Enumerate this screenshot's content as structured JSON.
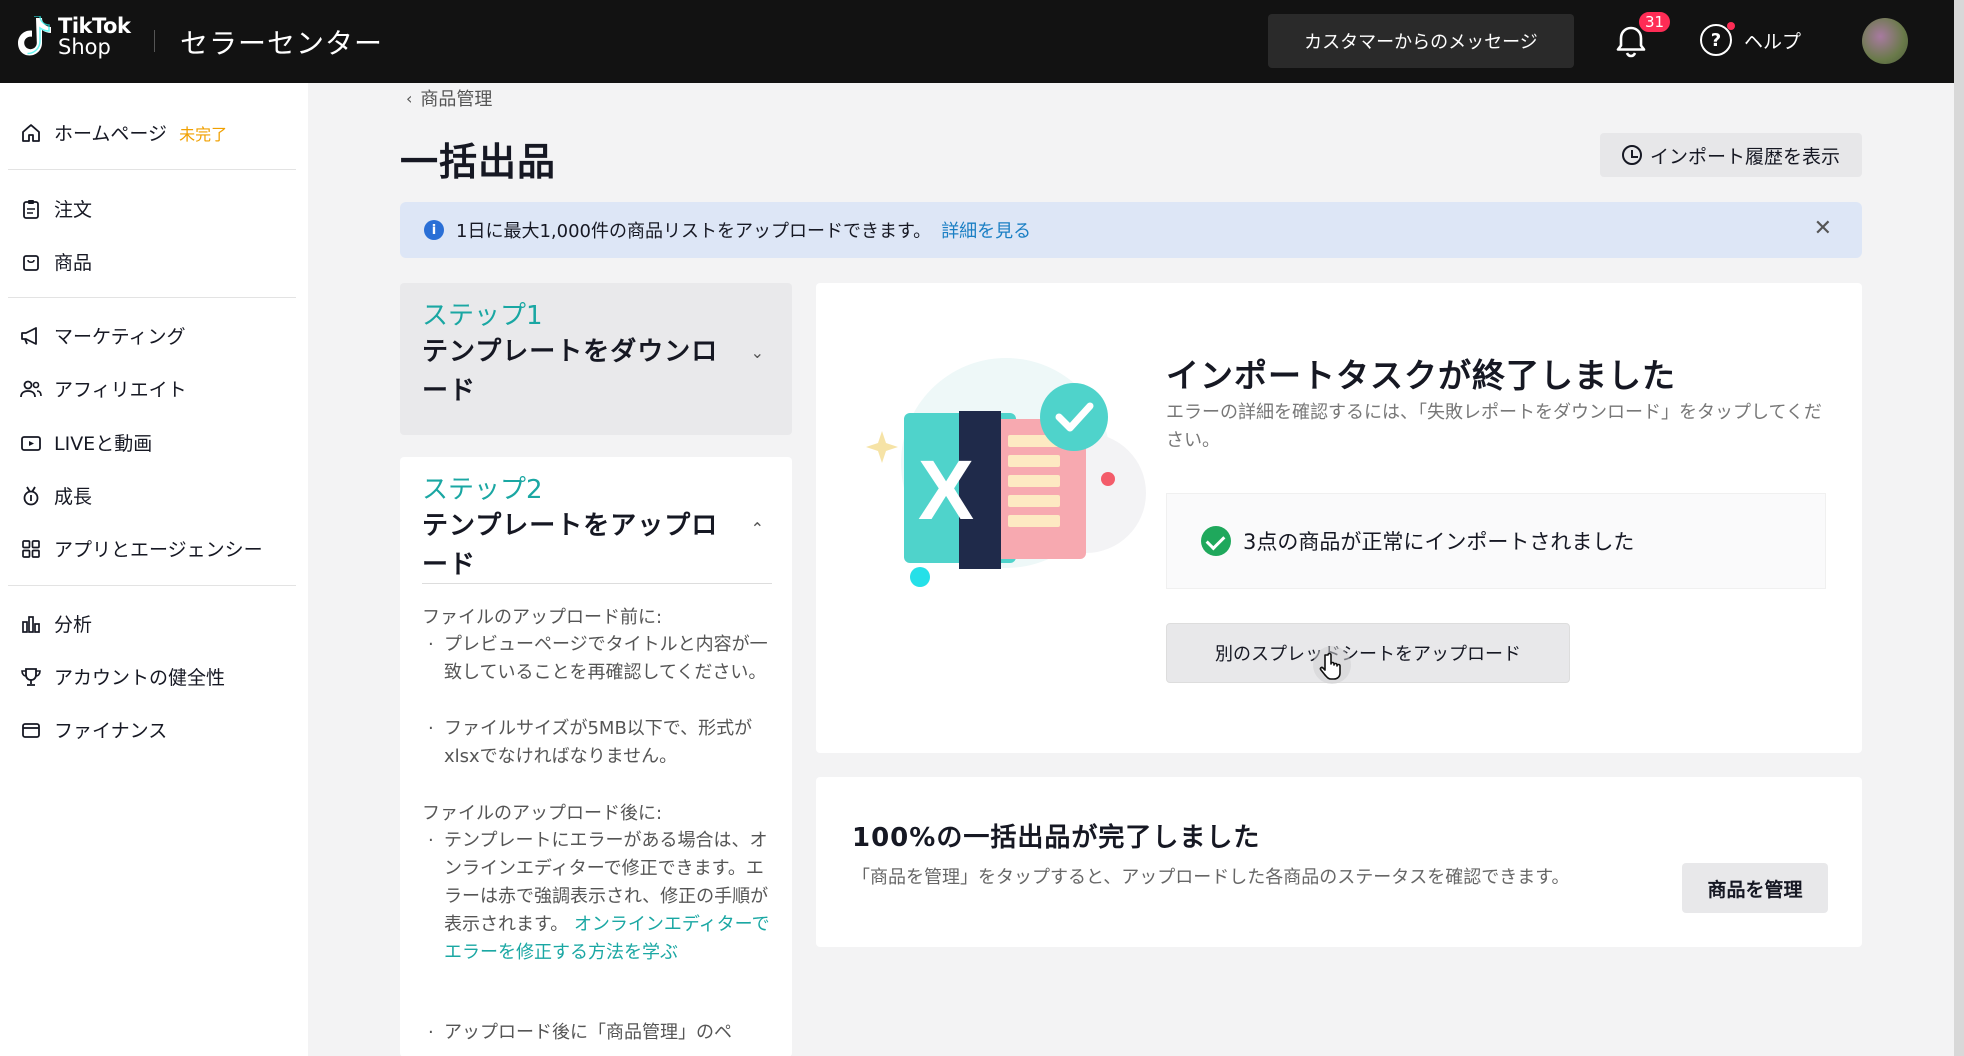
{
  "header": {
    "logo_line1": "TikTok",
    "logo_line2": "Shop",
    "app_title": "セラーセンター",
    "messages_button": "カスタマーからのメッセージ",
    "notifications_count": "31",
    "help_label": "ヘルプ"
  },
  "sidebar": {
    "items": [
      {
        "label": "ホームページ",
        "tag": "未完了",
        "icon": "home-icon"
      },
      {
        "label": "注文",
        "icon": "clipboard-icon"
      },
      {
        "label": "商品",
        "icon": "bag-icon"
      },
      {
        "label": "マーケティング",
        "icon": "megaphone-icon"
      },
      {
        "label": "アフィリエイト",
        "icon": "people-icon"
      },
      {
        "label": "LIVEと動画",
        "icon": "video-icon"
      },
      {
        "label": "成長",
        "icon": "medal-icon"
      },
      {
        "label": "アプリとエージェンシー",
        "icon": "grid-icon"
      },
      {
        "label": "分析",
        "icon": "bar-chart-icon"
      },
      {
        "label": "アカウントの健全性",
        "icon": "trophy-icon"
      },
      {
        "label": "ファイナンス",
        "icon": "wallet-icon"
      }
    ]
  },
  "main": {
    "breadcrumb": "商品管理",
    "title": "一括出品",
    "history_button": "インポート履歴を表示",
    "info_text": "1日に最大1,000件の商品リストをアップロードできます。",
    "info_link": "詳細を見る",
    "step1": {
      "number": "ステップ1",
      "name": "テンプレートをダウンロード"
    },
    "step2": {
      "number": "ステップ2",
      "name": "テンプレートをアップロード",
      "before_heading": "ファイルのアップロード前に:",
      "before_notes": [
        "プレビューページでタイトルと内容が一致していることを再確認してください。",
        "ファイルサイズが5MB以下で、形式がxlsxでなければなりません。"
      ],
      "after_heading": "ファイルのアップロード後に:",
      "after_note": "テンプレートにエラーがある場合は、オンラインエディターで修正できます。エラーは赤で強調表示され、修正の手順が表示されます。",
      "after_link": "オンラインエディターでエラーを修正する方法を学ぶ",
      "after_note2": "アップロード後に「商品管理」のペ"
    },
    "result": {
      "title": "インポートタスクが終了しました",
      "description": "エラーの詳細を確認するには、「失敗レポートをダウンロード」をタップしてください。",
      "success_text": "3点の商品が正常にインポートされました",
      "upload_another_button": "別のスプレッドシートをアップロード"
    },
    "completion": {
      "title": "100%の一括出品が完了しました",
      "description": "「商品を管理」をタップすると、アップロードした各商品のステータスを確認できます。",
      "manage_button": "商品を管理"
    }
  }
}
